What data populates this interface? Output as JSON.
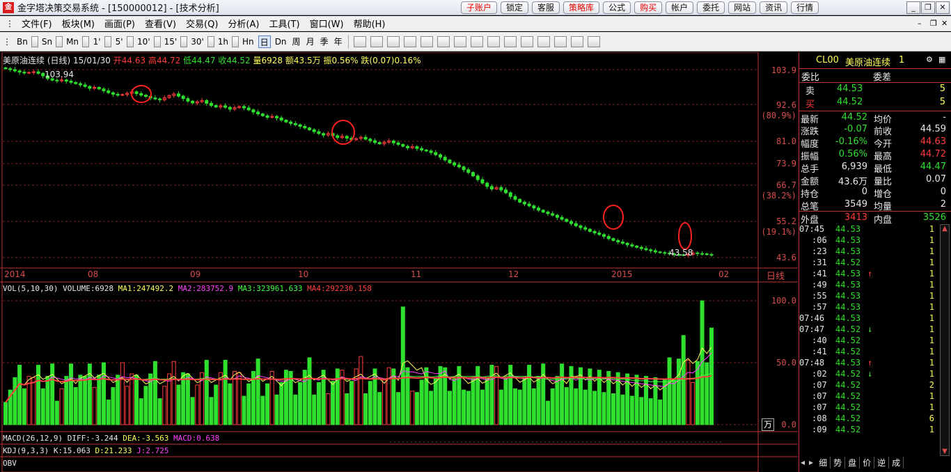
{
  "window": {
    "title": "金字塔决策交易系统 - [150000012] - [技术分析]",
    "logo": "金",
    "buttons": [
      "子账户",
      "锁定",
      "客服",
      "策略库",
      "公式",
      "购买",
      "帐户",
      "委托",
      "网站",
      "资讯",
      "行情"
    ],
    "red_buttons": [
      "子账户",
      "策略库",
      "购买"
    ],
    "controls": {
      "minimize": "_",
      "restore": "❐",
      "close": "✕"
    }
  },
  "menu": {
    "items": [
      "文件(F)",
      "板块(M)",
      "画面(P)",
      "查看(V)",
      "交易(Q)",
      "分析(A)",
      "工具(T)",
      "窗口(W)",
      "帮助(H)"
    ],
    "mdi_controls": [
      "–",
      "❐",
      "✕"
    ]
  },
  "toolbar": {
    "periods": [
      "Bn",
      "Sn",
      "Mn",
      "1'",
      "5'",
      "10'",
      "15'",
      "30'",
      "1h",
      "Hn",
      "日",
      "Dn",
      "周",
      "月",
      "季",
      "年"
    ],
    "selected_period": "日"
  },
  "chart": {
    "info": {
      "name": "美原油连续 (日线)",
      "date": "15/01/30",
      "open": "开44.63",
      "high": "高44.72",
      "low": "低44.47",
      "close": "收44.52",
      "vol": "量6928",
      "amount": "额43.5万",
      "amp": "振0.56%",
      "chg": "跌(0.07)0.16%"
    },
    "price_labels": [
      "103.9",
      "92.6",
      "81.0",
      "73.9",
      "66.7",
      "55.2",
      "43.6"
    ],
    "pct_labels": [
      "(80.9%)",
      "(38.2%)",
      "(19.1%)"
    ],
    "max_label": "103.94",
    "min_label": "43.58",
    "x_labels": [
      "2014",
      "08",
      "09",
      "10",
      "11",
      "12",
      "2015",
      "02"
    ],
    "period_label": "日线",
    "vol_line": {
      "name": "VOL(5,10,30)",
      "vol": "VOLUME:6928",
      "ma1": "MA1:247492.2",
      "ma2": "MA2:283752.9",
      "ma3": "MA3:323961.633",
      "ma4": "MA4:292230.158"
    },
    "vol_labels": [
      "100.0",
      "50.0",
      "0.0"
    ],
    "vol_unit": "万",
    "macd_line": {
      "name": "MACD(26,12,9)",
      "diff": "DIFF:-3.244",
      "dea": "DEA:-3.563",
      "macd": "MACD:0.638"
    },
    "kdj_line": {
      "name": "KDJ(9,3,3)",
      "k": "K:15.063",
      "d": "D:21.233",
      "j": "J:2.725"
    },
    "obv_line": "OBV"
  },
  "chart_data": {
    "type": "candlestick",
    "title": "美原油连续 (日线)",
    "y_axis_labels": [
      103.9,
      92.6,
      81.0,
      73.9,
      66.7,
      55.2,
      43.6
    ],
    "x": [
      "2014",
      "08",
      "09",
      "10",
      "11",
      "12",
      "2015",
      "02"
    ],
    "closes": [
      104.2,
      103.9,
      103.5,
      103.1,
      102.8,
      103.0,
      103.2,
      102.7,
      101.9,
      101.0,
      100.5,
      100.3,
      100.6,
      100.2,
      99.8,
      99.4,
      99.0,
      98.5,
      97.9,
      98.2,
      97.7,
      97.1,
      96.5,
      96.0,
      95.7,
      95.9,
      96.3,
      96.8,
      96.2,
      95.7,
      95.3,
      94.8,
      94.5,
      94.2,
      94.9,
      95.6,
      96.1,
      95.4,
      94.6,
      93.8,
      93.2,
      93.6,
      94.0,
      93.1,
      92.4,
      91.9,
      92.3,
      91.8,
      91.2,
      91.7,
      92.1,
      91.6,
      91.0,
      90.3,
      89.7,
      89.1,
      88.6,
      88.9,
      88.4,
      87.7,
      87.1,
      86.6,
      86.2,
      85.7,
      85.2,
      84.6,
      84.0,
      83.4,
      82.9,
      83.4,
      82.7,
      82.1,
      82.5,
      81.9,
      81.4,
      81.8,
      82.2,
      81.6,
      81.1,
      80.5,
      80.1,
      80.6,
      81.0,
      80.4,
      79.9,
      79.3,
      78.8,
      79.2,
      78.6,
      78.1,
      77.8,
      77.3,
      76.6,
      75.8,
      74.9,
      74.0,
      73.3,
      72.7,
      71.8,
      70.9,
      69.8,
      68.6,
      67.5,
      66.4,
      65.6,
      66.1,
      65.3,
      64.4,
      63.2,
      62.3,
      61.4,
      60.8,
      60.2,
      59.5,
      58.8,
      58.2,
      57.7,
      57.2,
      56.5,
      55.9,
      55.2,
      54.5,
      53.8,
      53.2,
      52.7,
      52.0,
      51.5,
      51.0,
      50.4,
      49.7,
      49.1,
      48.6,
      48.2,
      47.7,
      47.3,
      46.9,
      46.5,
      46.1,
      45.8,
      45.4,
      45.2,
      45.0,
      44.8,
      44.6,
      44.5,
      44.4,
      44.6,
      45.1,
      44.9,
      44.8,
      44.59,
      44.52
    ],
    "ylabel": "",
    "xlabel": ""
  },
  "quote": {
    "code": "CL00",
    "name": "美原油连续",
    "num": "1",
    "wb_label": "委比",
    "wc_label": "委差",
    "sell_label": "卖",
    "sell_price": "44.53",
    "sell_vol": "5",
    "buy_label": "买",
    "buy_price": "44.52",
    "buy_vol": "5",
    "rows": [
      {
        "l1": "最新",
        "v1": "44.52",
        "l2": "均价",
        "v2": "-"
      },
      {
        "l1": "涨跌",
        "v1": "-0.07",
        "l2": "前收",
        "v2": "44.59"
      },
      {
        "l1": "幅度",
        "v1": "-0.16%",
        "l2": "今开",
        "v2": "44.63"
      },
      {
        "l1": "振幅",
        "v1": "0.56%",
        "l2": "最高",
        "v2": "44.72"
      },
      {
        "l1": "总手",
        "v1": "6,939",
        "l2": "最低",
        "v2": "44.47"
      },
      {
        "l1": "金额",
        "v1": "43.6万",
        "l2": "量比",
        "v2": "0.07"
      },
      {
        "l1": "持仓",
        "v1": "0",
        "l2": "增仓",
        "v2": "0"
      },
      {
        "l1": "总笔",
        "v1": "3549",
        "l2": "均量",
        "v2": "2"
      },
      {
        "l1": "外盘",
        "v1": "3413",
        "l2": "内盘",
        "v2": "3526"
      }
    ]
  },
  "ticks": [
    {
      "t": "07:45",
      "p": "44.53",
      "v": "1",
      "up": false,
      "dn": false
    },
    {
      "t": ":06",
      "p": "44.53",
      "v": "1",
      "up": false,
      "dn": false
    },
    {
      "t": ":23",
      "p": "44.53",
      "v": "1",
      "up": false,
      "dn": false
    },
    {
      "t": ":31",
      "p": "44.52",
      "v": "1",
      "up": false,
      "dn": false
    },
    {
      "t": ":41",
      "p": "44.53",
      "v": "1",
      "up": true,
      "dn": false
    },
    {
      "t": ":49",
      "p": "44.53",
      "v": "1",
      "up": false,
      "dn": false
    },
    {
      "t": ":55",
      "p": "44.53",
      "v": "1",
      "up": false,
      "dn": false
    },
    {
      "t": ":57",
      "p": "44.53",
      "v": "1",
      "up": false,
      "dn": false
    },
    {
      "t": "07:46",
      "p": "44.53",
      "v": "1",
      "up": false,
      "dn": false
    },
    {
      "t": "07:47",
      "p": "44.52",
      "v": "1",
      "up": false,
      "dn": true
    },
    {
      "t": ":40",
      "p": "44.52",
      "v": "1",
      "up": false,
      "dn": false
    },
    {
      "t": ":41",
      "p": "44.52",
      "v": "1",
      "up": false,
      "dn": false
    },
    {
      "t": "07:48",
      "p": "44.53",
      "v": "1",
      "up": true,
      "dn": false
    },
    {
      "t": ":02",
      "p": "44.52",
      "v": "1",
      "up": false,
      "dn": true
    },
    {
      "t": ":07",
      "p": "44.52",
      "v": "2",
      "up": false,
      "dn": false
    },
    {
      "t": ":07",
      "p": "44.52",
      "v": "1",
      "up": false,
      "dn": false
    },
    {
      "t": ":07",
      "p": "44.52",
      "v": "1",
      "up": false,
      "dn": false
    },
    {
      "t": ":08",
      "p": "44.52",
      "v": "6",
      "up": false,
      "dn": false
    },
    {
      "t": ":09",
      "p": "44.52",
      "v": "1",
      "up": false,
      "dn": false
    }
  ],
  "bottom_tabs": [
    "细",
    "势",
    "盘",
    "价",
    "逆",
    "成"
  ],
  "colors": {
    "up": "#ff3c3c",
    "down": "#2fe02f",
    "text": "#e8e8e8",
    "axis": "#d84c4c",
    "ma_yellow": "#ffff5a",
    "ma_magenta": "#ff40ff",
    "ma_green": "#40ff40"
  }
}
